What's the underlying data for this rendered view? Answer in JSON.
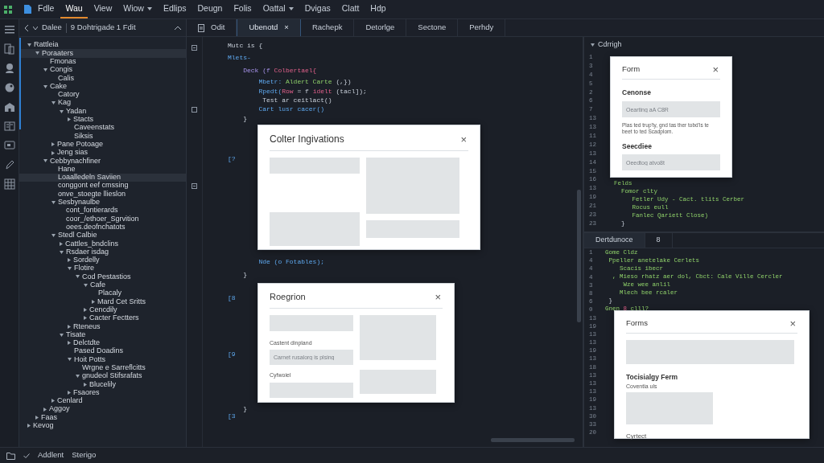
{
  "menu": [
    {
      "label": "Fdle",
      "selected": false,
      "dropdown": false
    },
    {
      "label": "Wau",
      "selected": true,
      "dropdown": false
    },
    {
      "label": "View",
      "selected": false,
      "dropdown": false
    },
    {
      "label": "Wiow",
      "selected": false,
      "dropdown": true
    },
    {
      "label": "Edlips",
      "selected": false,
      "dropdown": false
    },
    {
      "label": "Deugn",
      "selected": false,
      "dropdown": false
    },
    {
      "label": "Folis",
      "selected": false,
      "dropdown": false
    },
    {
      "label": "Oattal",
      "selected": false,
      "dropdown": true
    },
    {
      "label": "Dvigas",
      "selected": false,
      "dropdown": false
    },
    {
      "label": "Clatt",
      "selected": false,
      "dropdown": false
    },
    {
      "label": "Hdp",
      "selected": false,
      "dropdown": false
    }
  ],
  "sidebar": {
    "breadcrumb": "Dalee",
    "title": "9 Dohtrigade 1 Fdit",
    "tree": [
      {
        "label": "Rattleia",
        "selected": false,
        "expanded": true,
        "children": [
          {
            "label": "Poraaters",
            "selected": true,
            "expanded": true,
            "children": [
              {
                "label": "Fmonas",
                "selected": false
              },
              {
                "label": "Congis",
                "selected": false,
                "expanded": true,
                "children": [
                  {
                    "label": "Calis",
                    "selected": false
                  }
                ]
              },
              {
                "label": "Cake",
                "selected": false,
                "expanded": true,
                "children": [
                  {
                    "label": "Catory",
                    "selected": false
                  },
                  {
                    "label": "Kag",
                    "selected": false,
                    "expanded": true,
                    "children": [
                      {
                        "label": "Yadan",
                        "selected": false,
                        "expanded": true,
                        "children": [
                          {
                            "label": "Stacts",
                            "selected": false,
                            "expanded": false
                          },
                          {
                            "label": "Caveenstats",
                            "selected": false
                          },
                          {
                            "label": "Siksis",
                            "selected": false
                          }
                        ]
                      }
                    ]
                  },
                  {
                    "label": "Pane Potoage",
                    "selected": false,
                    "expanded": false
                  },
                  {
                    "label": "Jeng sias",
                    "selected": false,
                    "expanded": false
                  }
                ]
              },
              {
                "label": "Cebbynachfiner",
                "selected": false,
                "expanded": true,
                "children": [
                  {
                    "label": "Hane",
                    "selected": false
                  },
                  {
                    "label": "Loaalledeln Saviien",
                    "selected": true
                  },
                  {
                    "label": "conggont eef cmssing",
                    "selected": false
                  },
                  {
                    "label": "onve_stoegte llieslon",
                    "selected": false
                  },
                  {
                    "label": "Sesbynaulbe",
                    "selected": false,
                    "expanded": true,
                    "children": [
                      {
                        "label": "cont_fontierards",
                        "selected": false
                      },
                      {
                        "label": "coor_/ethoer_Sgrvition",
                        "selected": false
                      },
                      {
                        "label": "oees.deofnchatots",
                        "selected": false
                      }
                    ]
                  },
                  {
                    "label": "Stedl Calbie",
                    "selected": false,
                    "expanded": true,
                    "children": [
                      {
                        "label": "Cattles_bndclins",
                        "selected": false,
                        "expanded": false
                      },
                      {
                        "label": "Rsdaer isdag",
                        "selected": false,
                        "expanded": true,
                        "children": [
                          {
                            "label": "Sordelly",
                            "selected": false,
                            "expanded": false
                          },
                          {
                            "label": "Flotire",
                            "selected": false,
                            "expanded": true,
                            "children": [
                              {
                                "label": "Cod Pestastios",
                                "selected": false,
                                "expanded": true,
                                "children": [
                                  {
                                    "label": "Cafe",
                                    "selected": false,
                                    "expanded": true,
                                    "children": [
                                      {
                                        "label": "Placaly",
                                        "selected": false
                                      },
                                      {
                                        "label": "Mard Cet Sritts",
                                        "selected": false,
                                        "expanded": false
                                      }
                                    ]
                                  },
                                  {
                                    "label": "Cencdily",
                                    "selected": false,
                                    "expanded": false
                                  },
                                  {
                                    "label": "Cacter Fectters",
                                    "selected": false,
                                    "expanded": false
                                  }
                                ]
                              }
                            ]
                          },
                          {
                            "label": "Rteneus",
                            "selected": false,
                            "expanded": false
                          }
                        ]
                      },
                      {
                        "label": "Tisate",
                        "selected": false,
                        "expanded": true,
                        "children": [
                          {
                            "label": "Delctdte",
                            "selected": false,
                            "expanded": false
                          },
                          {
                            "label": "Pased Doadins",
                            "selected": false
                          },
                          {
                            "label": "Hoit Potts",
                            "selected": false,
                            "expanded": true,
                            "children": [
                              {
                                "label": "Wrgne e Sarreflcitts",
                                "selected": false
                              },
                              {
                                "label": "gnudeol Stifsrafats",
                                "selected": false,
                                "expanded": true,
                                "children": [
                                  {
                                    "label": "Blucelily",
                                    "selected": false,
                                    "expanded": false
                                  }
                                ]
                              }
                            ]
                          },
                          {
                            "label": "Fsaores",
                            "selected": false,
                            "expanded": false
                          }
                        ]
                      }
                    ]
                  },
                  {
                    "label": "Cenlard",
                    "selected": false,
                    "expanded": false
                  }
                ]
              },
              {
                "label": "Aggoy",
                "selected": false,
                "expanded": false
              }
            ]
          },
          {
            "label": "Faas",
            "selected": false,
            "expanded": false
          }
        ]
      },
      {
        "label": "Kevog",
        "selected": false,
        "expanded": false
      }
    ]
  },
  "tabs": [
    {
      "label": "Odit",
      "selected": false
    },
    {
      "label": "Ubenotd",
      "selected": true,
      "close": "×"
    },
    {
      "label": "Rachepk",
      "selected": false
    },
    {
      "label": "Detorlge",
      "selected": false
    },
    {
      "label": "Sectone",
      "selected": false
    },
    {
      "label": "Perhdy",
      "selected": false
    }
  ],
  "editor": {
    "lines": [
      [
        {
          "kind": "plain",
          "text": "Mutc is {"
        }
      ],
      [
        {
          "kind": "keyword",
          "text": "Mlets-"
        }
      ],
      [
        {
          "kind": "type",
          "text": "    Deck (f "
        },
        {
          "kind": "name",
          "text": "Colbertael{"
        }
      ],
      [
        {
          "kind": "keyword",
          "text": "        Mbetr: "
        },
        {
          "kind": "string",
          "text": "Aldert Carte"
        },
        {
          "kind": "plain",
          "text": " (,})"
        }
      ],
      [
        {
          "kind": "keyword",
          "text": "        Rpedt("
        },
        {
          "kind": "name",
          "text": "Row"
        },
        {
          "kind": "plain",
          "text": " = f "
        },
        {
          "kind": "name",
          "text": "idelt"
        },
        {
          "kind": "plain",
          "text": " (tacl]);"
        }
      ],
      [
        {
          "kind": "plain",
          "text": "         Test ar ceitlact()"
        }
      ],
      [
        {
          "kind": "keyword",
          "text": "        Cart lusr cacer()"
        }
      ],
      [
        {
          "kind": "plain",
          "text": "    }"
        }
      ],
      [
        {
          "kind": "keyword",
          "text": "[?"
        }
      ],
      [
        {
          "kind": "keyword",
          "text": "        Nde (o Fotables);"
        }
      ],
      [
        {
          "kind": "plain",
          "text": "    }"
        }
      ],
      [
        {
          "kind": "keyword",
          "text": "[8"
        }
      ],
      [
        {
          "kind": "keyword",
          "text": "[9"
        }
      ],
      [
        {
          "kind": "plain",
          "text": "    }"
        }
      ],
      [
        {
          "kind": "keyword",
          "text": "[3"
        }
      ]
    ],
    "dialogs": [
      {
        "kind": "blocks",
        "title": "Colter Ingivations",
        "close": "×"
      },
      {
        "kind": "form-grid",
        "title": "Roegrion",
        "close": "×",
        "fields": [
          {
            "label": "Castent dinpland",
            "placeholder": "Carnet rusalorg is plsing"
          },
          {
            "label": "Cyfwoiel"
          }
        ]
      }
    ]
  },
  "outline": {
    "title": "Cdrrigh",
    "line_numbers": [
      "1",
      "3",
      "4",
      "5",
      "2",
      "6",
      "7",
      "13",
      "13",
      "11",
      "12",
      "13",
      "14",
      "15",
      "16",
      "13",
      "19",
      "21",
      "23",
      "23"
    ],
    "lines": [
      [
        {
          "kind": "string",
          "text": "Felds"
        }
      ],
      [
        {
          "kind": "string",
          "text": "  Fomor clty"
        }
      ],
      [
        {
          "kind": "string",
          "text": "     Fetler Udy - Cact. tlits Cerber"
        }
      ],
      [
        {
          "kind": "string",
          "text": "     Rocus eull"
        }
      ],
      [
        {
          "kind": "string",
          "text": "     Fanlec Qariett Close)"
        }
      ],
      [
        {
          "kind": "plain",
          "text": "  }"
        }
      ]
    ],
    "dialog": {
      "kind": "form",
      "title": "Form",
      "close": "×",
      "sections": [
        {
          "heading": "Cenonse",
          "placeholder": "Oearting aA C8R",
          "help": "Plas ted trup'ty, gnd tas ther tobd'is te beet to ted Scadplom."
        },
        {
          "heading": "Seecdiee",
          "placeholder": "Oeedtog atvo8t"
        }
      ]
    }
  },
  "panel": {
    "tabs": [
      {
        "label": "Dertdunoce",
        "selected": true
      },
      {
        "label": "8",
        "selected": false
      }
    ],
    "line_numbers": [
      "1",
      "4",
      "4",
      "4",
      "3",
      "8",
      "6",
      "0",
      "13",
      "19",
      "13",
      "13",
      "19",
      "13",
      "18",
      "13",
      "13",
      "13",
      "19",
      "13",
      "30",
      "33",
      "20"
    ],
    "lines": [
      [
        {
          "kind": "string",
          "text": "Gome Cldz"
        }
      ],
      [
        {
          "kind": "string",
          "text": " Ppeller anetelake Cerlets"
        }
      ],
      [
        {
          "kind": "string",
          "text": "    Scacis ibecr"
        }
      ],
      [
        {
          "kind": "string",
          "text": "  , Mieso rhatz aer dol, Cbct: Cale Ville Cercler"
        }
      ],
      [
        {
          "kind": "string",
          "text": "     Wze wee anlil"
        }
      ],
      [
        {
          "kind": "string",
          "text": "    Mlech bee rcaler"
        }
      ],
      [
        {
          "kind": "plain",
          "text": " }"
        }
      ],
      [
        {
          "kind": "string",
          "text": "Gnen "
        },
        {
          "kind": "name",
          "text": "8"
        },
        {
          "kind": "string",
          "text": " clll?"
        }
      ]
    ],
    "dialog": {
      "kind": "form-blocks",
      "title": "Forms",
      "close": "×",
      "heading": "Tocisialgy Ferm",
      "note": "Coventia uls",
      "label": "Cyrtect"
    }
  },
  "status": [
    "Addlent",
    "Sterigo"
  ]
}
